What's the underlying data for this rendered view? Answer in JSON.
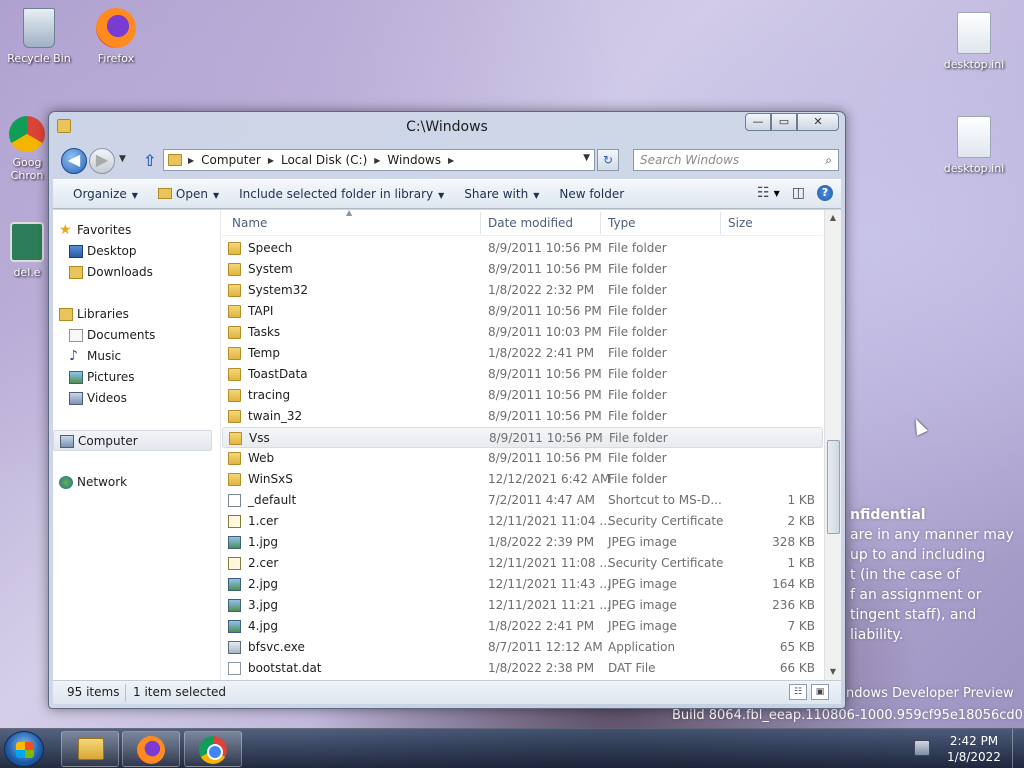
{
  "desktop": {
    "icons": {
      "recycle_bin": "Recycle Bin",
      "firefox": "Firefox",
      "chrome": "Goog\nChron",
      "dele": "del.e",
      "ini1": "desktop.ini",
      "ini2": "desktop.ini"
    },
    "watermark": {
      "line1": "nfidential",
      "line2": "are in any manner may",
      "line3": "up to and including",
      "line4": "t (in the case of",
      "line5": "f an assignment or",
      "line6": "tingent staff), and",
      "line7": "liability.",
      "build1": "ndows Developer Preview",
      "build2": "Build 8064.fbl_eeap.110806-1000.959cf95e18056cd0"
    }
  },
  "window": {
    "title": "C:\\Windows",
    "caption": {
      "min": "—",
      "max": "▭",
      "close": "✕"
    },
    "nav": {
      "back": "◀",
      "fwd": "▶",
      "drop": "▼",
      "up": "⇧",
      "refresh": "↻"
    },
    "address": {
      "crumbs": [
        "Computer",
        "Local Disk (C:)",
        "Windows"
      ],
      "sep": "▶",
      "drop": "▼"
    },
    "search": {
      "placeholder": "Search Windows",
      "icon": "⌕"
    },
    "toolbar": {
      "organize": "Organize",
      "open": "Open",
      "include": "Include selected folder in library",
      "share": "Share with",
      "new_folder": "New folder",
      "arrow": "▼",
      "view_icon": "☷",
      "preview_icon": "◫",
      "help_icon": "?"
    },
    "nav_pane": {
      "favorites": "Favorites",
      "desktop": "Desktop",
      "downloads": "Downloads",
      "libraries": "Libraries",
      "documents": "Documents",
      "music": "Music",
      "pictures": "Pictures",
      "videos": "Videos",
      "computer": "Computer",
      "network": "Network"
    },
    "columns": {
      "name": "Name",
      "date": "Date modified",
      "type": "Type",
      "size": "Size",
      "sort_arrow": "▲"
    },
    "files": [
      {
        "name": "Speech",
        "date": "8/9/2011 10:56 PM",
        "type": "File folder",
        "size": "",
        "icon": "folder"
      },
      {
        "name": "System",
        "date": "8/9/2011 10:56 PM",
        "type": "File folder",
        "size": "",
        "icon": "folder"
      },
      {
        "name": "System32",
        "date": "1/8/2022 2:32 PM",
        "type": "File folder",
        "size": "",
        "icon": "folder"
      },
      {
        "name": "TAPI",
        "date": "8/9/2011 10:56 PM",
        "type": "File folder",
        "size": "",
        "icon": "folder"
      },
      {
        "name": "Tasks",
        "date": "8/9/2011 10:03 PM",
        "type": "File folder",
        "size": "",
        "icon": "folder"
      },
      {
        "name": "Temp",
        "date": "1/8/2022 2:41 PM",
        "type": "File folder",
        "size": "",
        "icon": "folder"
      },
      {
        "name": "ToastData",
        "date": "8/9/2011 10:56 PM",
        "type": "File folder",
        "size": "",
        "icon": "folder"
      },
      {
        "name": "tracing",
        "date": "8/9/2011 10:56 PM",
        "type": "File folder",
        "size": "",
        "icon": "folder"
      },
      {
        "name": "twain_32",
        "date": "8/9/2011 10:56 PM",
        "type": "File folder",
        "size": "",
        "icon": "folder"
      },
      {
        "name": "Vss",
        "date": "8/9/2011 10:56 PM",
        "type": "File folder",
        "size": "",
        "icon": "folder",
        "selected": true
      },
      {
        "name": "Web",
        "date": "8/9/2011 10:56 PM",
        "type": "File folder",
        "size": "",
        "icon": "folder"
      },
      {
        "name": "WinSxS",
        "date": "12/12/2021 6:42 AM",
        "type": "File folder",
        "size": "",
        "icon": "folder"
      },
      {
        "name": "_default",
        "date": "7/2/2011 4:47 AM",
        "type": "Shortcut to MS-D...",
        "size": "1 KB",
        "icon": "shortcut"
      },
      {
        "name": "1.cer",
        "date": "12/11/2021 11:04 ...",
        "type": "Security Certificate",
        "size": "2 KB",
        "icon": "cert"
      },
      {
        "name": "1.jpg",
        "date": "1/8/2022 2:39 PM",
        "type": "JPEG image",
        "size": "328 KB",
        "icon": "img"
      },
      {
        "name": "2.cer",
        "date": "12/11/2021 11:08 ...",
        "type": "Security Certificate",
        "size": "1 KB",
        "icon": "cert"
      },
      {
        "name": "2.jpg",
        "date": "12/11/2021 11:43 ...",
        "type": "JPEG image",
        "size": "164 KB",
        "icon": "img"
      },
      {
        "name": "3.jpg",
        "date": "12/11/2021 11:21 ...",
        "type": "JPEG image",
        "size": "236 KB",
        "icon": "img"
      },
      {
        "name": "4.jpg",
        "date": "1/8/2022 2:41 PM",
        "type": "JPEG image",
        "size": "7 KB",
        "icon": "img"
      },
      {
        "name": "bfsvc.exe",
        "date": "8/7/2011 12:12 AM",
        "type": "Application",
        "size": "65 KB",
        "icon": "exe"
      },
      {
        "name": "bootstat.dat",
        "date": "1/8/2022 2:38 PM",
        "type": "DAT File",
        "size": "66 KB",
        "icon": "file"
      }
    ],
    "scroll": {
      "up": "▲",
      "down": "▼"
    },
    "status": {
      "count": "95 items",
      "selected": "1 item selected",
      "details_icon": "☷",
      "tiles_icon": "▣"
    }
  },
  "taskbar": {
    "time": "2:42 PM",
    "date": "1/8/2022"
  }
}
